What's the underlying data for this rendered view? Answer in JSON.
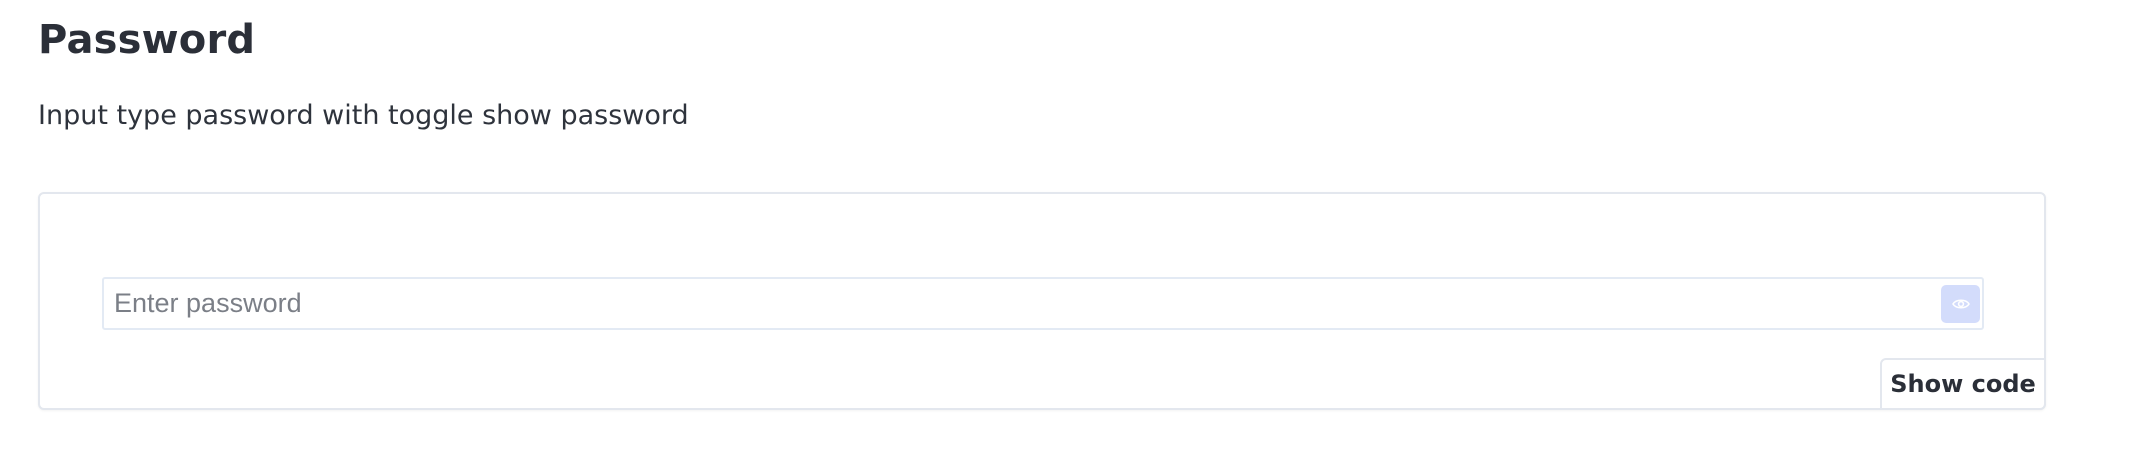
{
  "header": {
    "title": "Password",
    "description": "Input type password with toggle show password"
  },
  "demo": {
    "input": {
      "value": "",
      "placeholder": "Enter password",
      "type": "password"
    },
    "toggle": {
      "icon": "eye-icon",
      "background": "#d3dcfb",
      "icon_color": "#ffffff"
    },
    "show_code_label": "Show code"
  }
}
